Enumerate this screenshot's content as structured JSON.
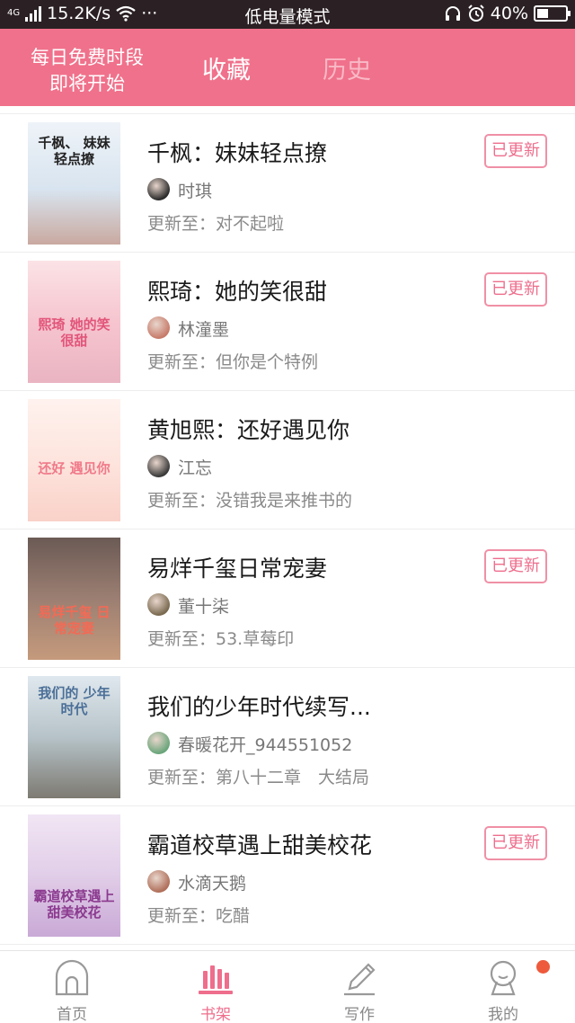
{
  "status_bar": {
    "network": "4G",
    "speed": "15.2K/s",
    "more": "···",
    "mode": "低电量模式",
    "battery": "40%",
    "battery_level": 0.4
  },
  "header": {
    "promo_line1": "每日免费时段",
    "promo_line2": "即将开始",
    "tab_favorites": "收藏",
    "tab_history": "历史",
    "accent_color": "#f0718b"
  },
  "books": [
    {
      "title": "千枫：妹妹轻点撩",
      "author": "时琪",
      "update": "更新至：对不起啦",
      "badge": "已更新",
      "cover_text": "千枫、 妹妹轻点撩"
    },
    {
      "title": "熙琦：她的笑很甜",
      "author": "林潼墨",
      "update": "更新至：但你是个特例",
      "badge": "已更新",
      "cover_text": "熙琦 她的笑很甜"
    },
    {
      "title": "黄旭熙：还好遇见你",
      "author": "江忘",
      "update": "更新至：没错我是来推书的",
      "badge": "",
      "cover_text": "还好 遇见你"
    },
    {
      "title": "易烊千玺日常宠妻",
      "author": "董十柒",
      "update": "更新至：53.草莓印",
      "badge": "已更新",
      "cover_text": "易烊千玺 日常宠妻"
    },
    {
      "title": "我们的少年时代续写...",
      "author": "春暖花开_944551052",
      "update": "更新至：第八十二章　大结局",
      "badge": "",
      "cover_text": "我们的 少年时代"
    },
    {
      "title": "霸道校草遇上甜美校花",
      "author": "水滴天鹅",
      "update": "更新至：吃醋",
      "badge": "已更新",
      "cover_text": "霸道校草遇上 甜美校花"
    }
  ],
  "bottom_nav": [
    {
      "label": "首页",
      "icon": "home-icon",
      "active": false
    },
    {
      "label": "书架",
      "icon": "bookshelf-icon",
      "active": true
    },
    {
      "label": "写作",
      "icon": "pen-icon",
      "active": false
    },
    {
      "label": "我的",
      "icon": "profile-icon",
      "active": false
    }
  ]
}
